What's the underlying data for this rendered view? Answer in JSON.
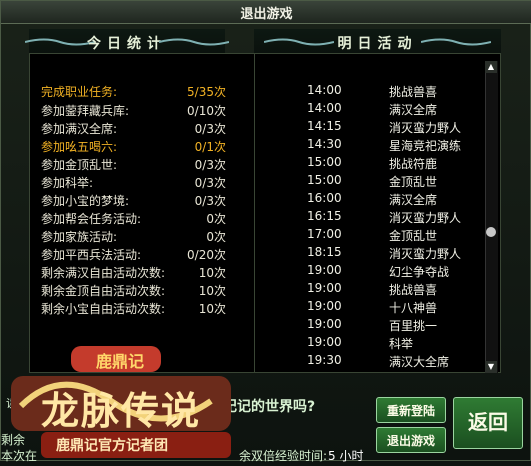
{
  "window": {
    "title": "退出游戏"
  },
  "headers": {
    "left": "今日统计",
    "right": "明日活动"
  },
  "stats": [
    {
      "label": "完成职业任务:",
      "value": "5/35次",
      "highlight": true
    },
    {
      "label": "参加蓥拜藏兵库:",
      "value": "0/10次"
    },
    {
      "label": "参加满汉全席:",
      "value": "0/3次"
    },
    {
      "label": "参加吆五喝六:",
      "value": "0/1次",
      "highlight": true
    },
    {
      "label": "参加金顶乱世:",
      "value": "0/3次"
    },
    {
      "label": "参加科举:",
      "value": "0/3次"
    },
    {
      "label": "参加小宝的梦境:",
      "value": "0/3次"
    },
    {
      "label": "参加帮会任务活动:",
      "value": "0次"
    },
    {
      "label": "参加家族活动:",
      "value": "0次"
    },
    {
      "label": "参加平西兵法活动:",
      "value": "0/20次"
    },
    {
      "label": "剩余满汉自由活动次数:",
      "value": "10次"
    },
    {
      "label": "剩余金顶自由活动次数:",
      "value": "10次"
    },
    {
      "label": "剩余小宝自由活动次数:",
      "value": "10次"
    }
  ],
  "activities": [
    {
      "time": "14:00",
      "name": "挑战兽喜"
    },
    {
      "time": "14:00",
      "name": "满汉全席"
    },
    {
      "time": "14:15",
      "name": "消灭蛮力野人"
    },
    {
      "time": "14:30",
      "name": "星海竞祀演练"
    },
    {
      "time": "15:00",
      "name": "挑战符鹿"
    },
    {
      "time": "15:00",
      "name": "金顶乱世"
    },
    {
      "time": "16:00",
      "name": "满汉全席"
    },
    {
      "time": "16:15",
      "name": "消灭蛮力野人"
    },
    {
      "time": "17:00",
      "name": "金顶乱世"
    },
    {
      "time": "18:15",
      "name": "消灭蛮力野人"
    },
    {
      "time": "19:00",
      "name": "幻尘争夺战"
    },
    {
      "time": "19:00",
      "name": "挑战兽喜"
    },
    {
      "time": "19:00",
      "name": "十八神兽"
    },
    {
      "time": "19:00",
      "name": "百里挑一"
    },
    {
      "time": "19:00",
      "name": "科举"
    },
    {
      "time": "19:30",
      "name": "满汉大全席"
    }
  ],
  "bottom": {
    "question": "記记的世界吗?",
    "remaining_label": "剩余",
    "local_label": "本次在",
    "time_label": "余双倍经验时间:",
    "time_value": "5 小时",
    "left_fragment": "读友"
  },
  "buttons": {
    "relogin": "重新登陆",
    "exit": "退出游戏",
    "back": "返回"
  },
  "logo": {
    "brand": "鹿鼎记",
    "big_text": "龙脉传说",
    "tagline": "鹿鼎记官方记者团"
  }
}
